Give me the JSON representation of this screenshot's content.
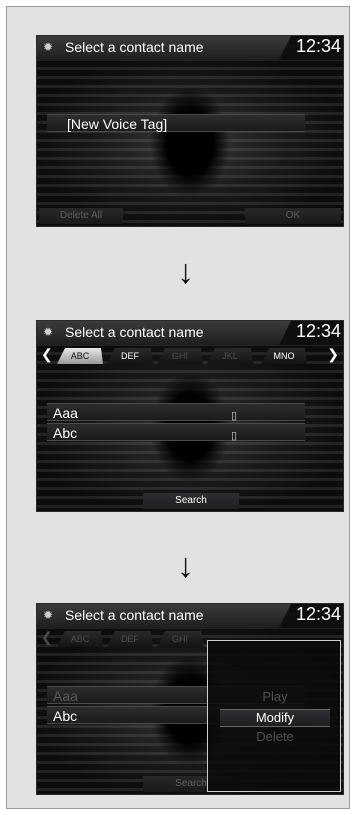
{
  "screens": [
    {
      "title": "Select a contact name",
      "time": "12:34",
      "rows": [
        {
          "label": "[New Voice Tag]"
        }
      ],
      "bottom": {
        "left": "Delete All",
        "right": "OK"
      }
    },
    {
      "title": "Select a contact name",
      "time": "12:34",
      "tabs": [
        "ABC",
        "DEF",
        "GHI",
        "JKL",
        "MNO"
      ],
      "rows": [
        {
          "label": "Aaa"
        },
        {
          "label": "Abc"
        }
      ],
      "bottom": {
        "center": "Search"
      }
    },
    {
      "title": "Select a contact name",
      "time": "12:34",
      "tabs": [
        "ABC",
        "DEF",
        "GHI"
      ],
      "rows": [
        {
          "label": "Aaa"
        },
        {
          "label": "Abc"
        }
      ],
      "bottom": {
        "center": "Search"
      },
      "popup": {
        "items": [
          "Play",
          "Modify",
          "Delete"
        ]
      }
    }
  ],
  "arrows": [
    "↓",
    "↓"
  ],
  "icons": {
    "title_icon": "gear-icon",
    "phone_icon": "mobile-phone-icon"
  },
  "colors": {
    "screen_bg": "#0f0f10",
    "frame_bg": "#e2e2e2"
  }
}
